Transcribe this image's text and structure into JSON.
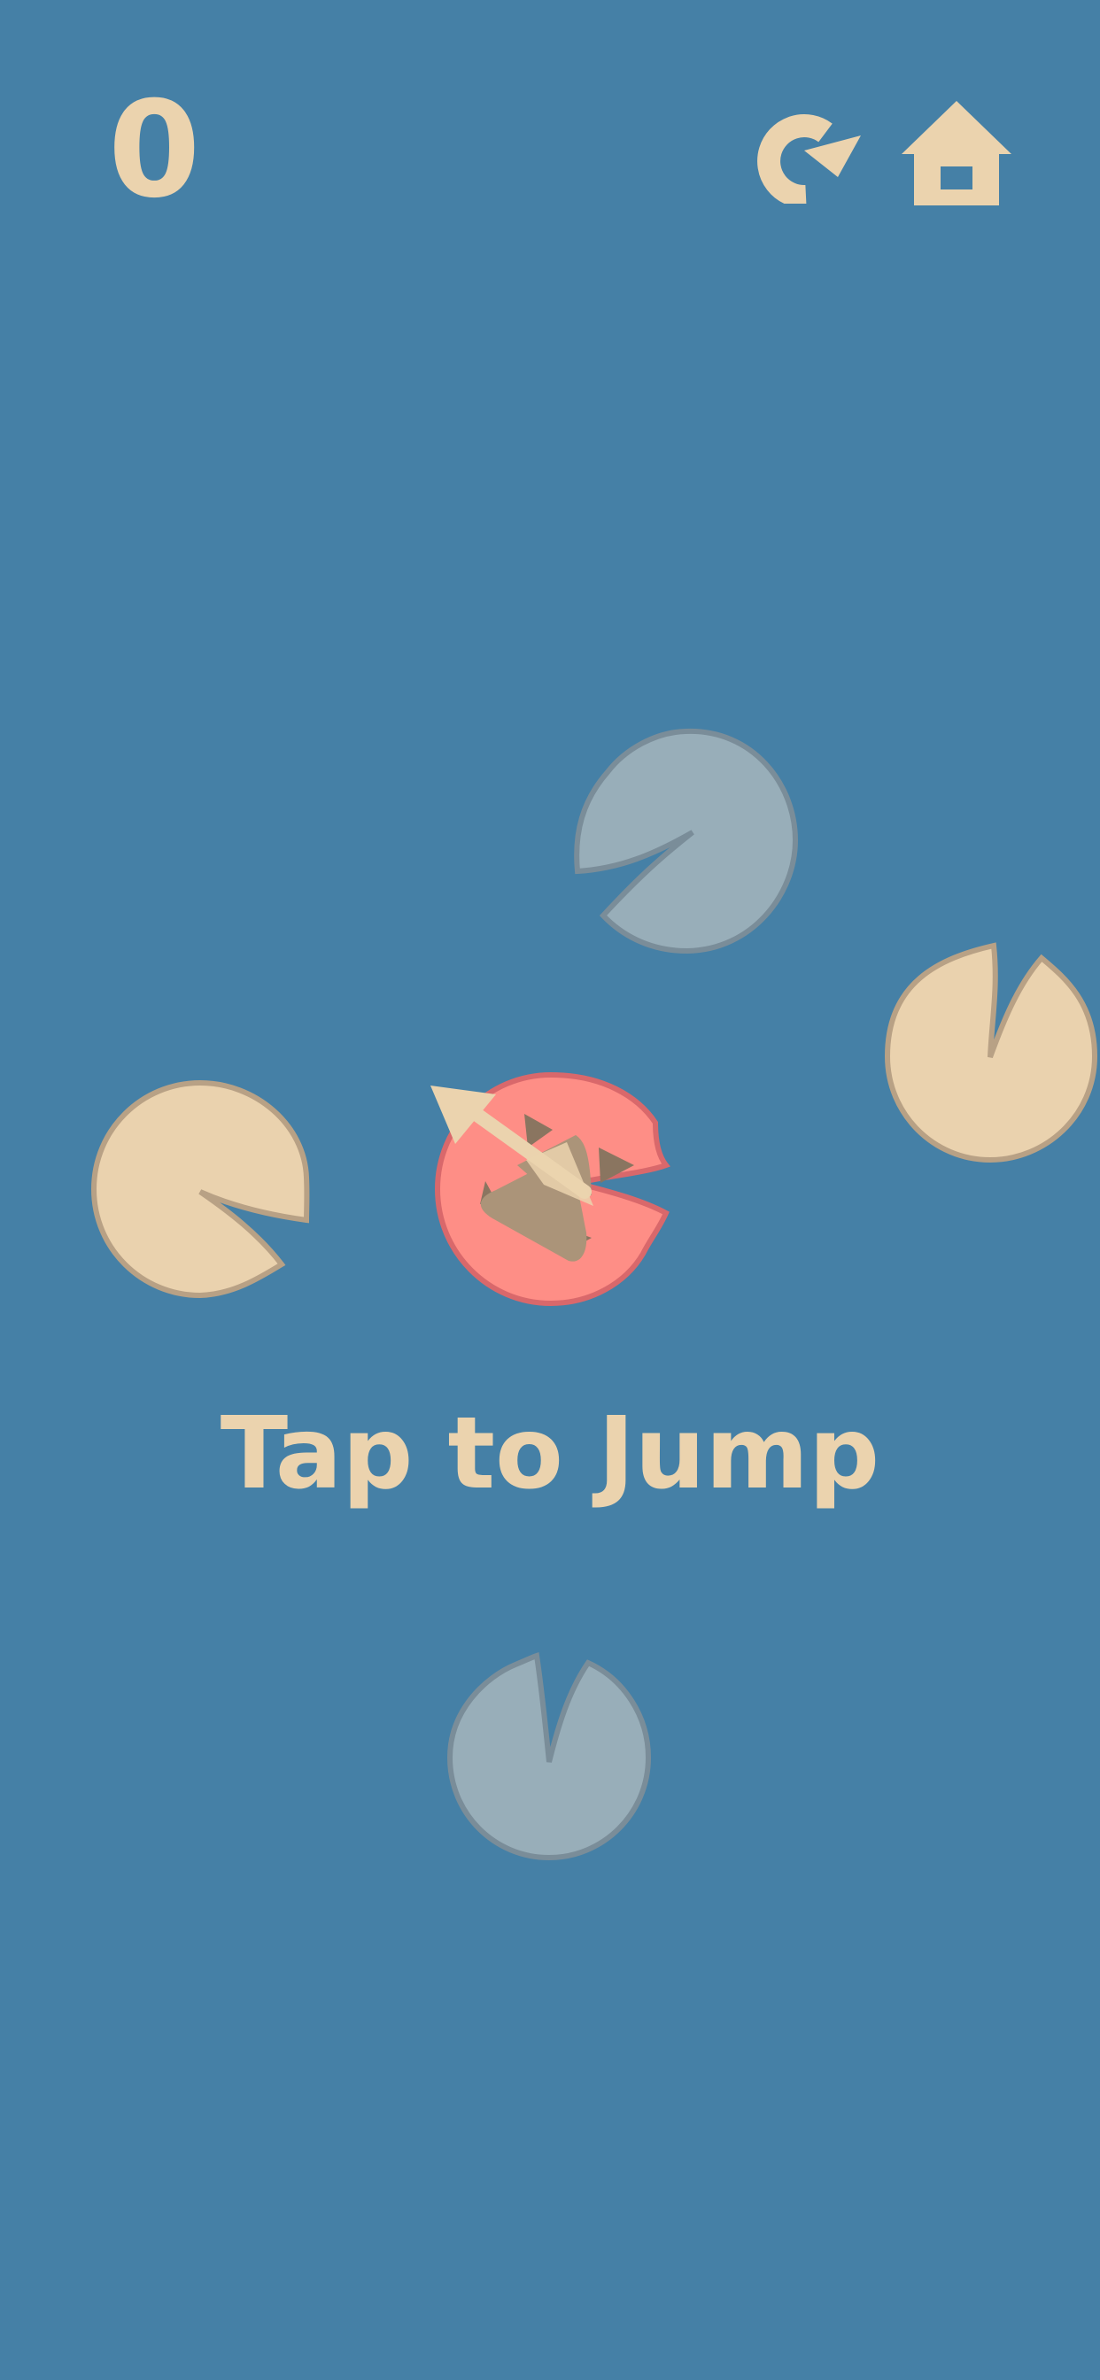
{
  "hud": {
    "score": "0",
    "restart_icon": "restart-icon",
    "home_icon": "home-icon"
  },
  "prompt": "Tap to Jump",
  "colors": {
    "water": "#4580a6",
    "cream": "#ebd3ae",
    "pad_cream": "#ead2ae",
    "pad_grey": "#98aeb9",
    "pad_active": "#fe8e86",
    "frog": "#ab9479"
  },
  "pads": [
    {
      "name": "lily-pad-top-grey",
      "state": "distant"
    },
    {
      "name": "lily-pad-right-cream",
      "state": "available"
    },
    {
      "name": "lily-pad-left-cream",
      "state": "available"
    },
    {
      "name": "lily-pad-current-red",
      "state": "current"
    },
    {
      "name": "lily-pad-bottom-grey",
      "state": "distant"
    }
  ]
}
